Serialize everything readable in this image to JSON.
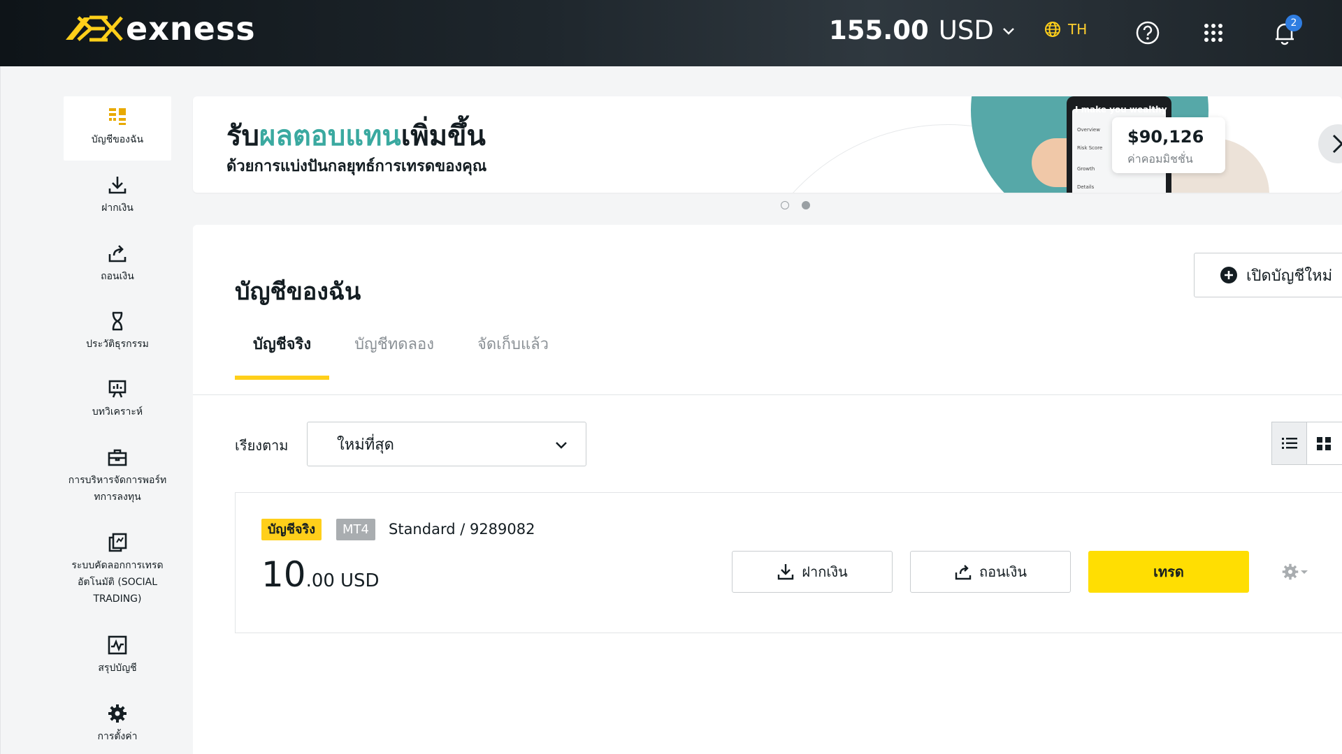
{
  "header": {
    "logo_text": "exness",
    "balance_amount": "155.00",
    "balance_currency": "USD",
    "language": "TH",
    "notification_count": "2"
  },
  "sidebar": {
    "items": [
      {
        "label": "บัญชีของฉัน",
        "icon": "grid-icon",
        "active": true
      },
      {
        "label": "ฝากเงิน",
        "icon": "download-icon"
      },
      {
        "label": "ถอนเงิน",
        "icon": "upload-icon"
      },
      {
        "label": "ประวัติธุรกรรม",
        "icon": "hourglass-icon"
      },
      {
        "label": "บทวิเคราะห์",
        "icon": "presentation-icon"
      },
      {
        "label": "การบริหารจัดการพอร์ท",
        "label2": "ทการลงทุน",
        "icon": "briefcase-icon"
      },
      {
        "label": "ระบบคัดลอกการเทรด",
        "label2": "อัตโนมัติ (SOCIAL",
        "label3": "TRADING)",
        "icon": "copy-icon"
      },
      {
        "label": "สรุปบัญชี",
        "icon": "chart-icon"
      },
      {
        "label": "การตั้งค่า",
        "icon": "gear-icon"
      }
    ]
  },
  "banner": {
    "title_part1": "รับ",
    "title_highlight": "ผลตอบแทน",
    "title_part2": "เพิ่มขึ้น",
    "subtitle": "ด้วยการแบ่งปันกลยุทธ์การเทรดของคุณ",
    "phone_heading": "I make you wealthy",
    "phone_rows": [
      "Overview",
      "Risk Score",
      "Growth",
      "Details"
    ],
    "stat_value": "$90,126",
    "stat_label": "ค่าคอมมิชชั่น",
    "slides": 2,
    "active_slide": 2
  },
  "main": {
    "page_title": "บัญชีของฉัน",
    "new_account_label": "เปิดบัญชีใหม่",
    "tabs": [
      {
        "label": "บัญชีจริง",
        "active": true
      },
      {
        "label": "บัญชีทดลอง"
      },
      {
        "label": "จัดเก็บแล้ว"
      }
    ],
    "sort_label": "เรียงตาม",
    "sort_value": "ใหม่ที่สุด",
    "view_mode": "list"
  },
  "account": {
    "type_tag": "บัญชีจริง",
    "platform_tag": "MT4",
    "name": "Standard / 9289082",
    "balance_int": "10",
    "balance_dec": ".00",
    "currency": "USD",
    "deposit_label": "ฝากเงิน",
    "withdraw_label": "ถอนเงิน",
    "trade_label": "เทรด"
  },
  "colors": {
    "brand_yellow": "#ffde02",
    "tab_underline": "#ffcf1a",
    "banner_accent": "#3aa9a0",
    "badge_blue": "#2f7de1"
  }
}
